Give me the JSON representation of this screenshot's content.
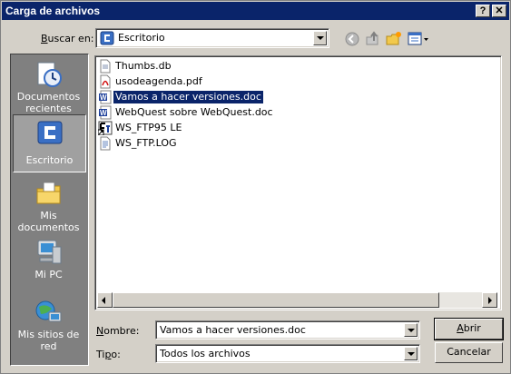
{
  "window": {
    "title": "Carga de archivos",
    "help_button": "?",
    "close_button": "✕"
  },
  "lookin": {
    "label_u": "B",
    "label_rest": "uscar en:",
    "value": "Escritorio"
  },
  "toolbar": {
    "icons": [
      "back-icon",
      "up-folder-icon",
      "new-folder-icon",
      "view-menu-icon"
    ]
  },
  "places": [
    {
      "label": "Documentos recientes",
      "icon": "recent-documents-icon"
    },
    {
      "label": "Escritorio",
      "icon": "desktop-icon",
      "active": true
    },
    {
      "label": "Mis documentos",
      "icon": "my-documents-icon"
    },
    {
      "label": "Mi PC",
      "icon": "my-computer-icon"
    },
    {
      "label": "Mis sitios de red",
      "icon": "network-places-icon"
    }
  ],
  "files": [
    {
      "name": "Thumbs.db",
      "icon": "generic-file-icon"
    },
    {
      "name": "usodeagenda.pdf",
      "icon": "pdf-file-icon"
    },
    {
      "name": "Vamos a hacer versiones.doc",
      "icon": "word-doc-icon",
      "selected": true
    },
    {
      "name": "WebQuest sobre WebQuest.doc",
      "icon": "word-doc-icon"
    },
    {
      "name": "WS_FTP95 LE",
      "icon": "ftp-shortcut-icon"
    },
    {
      "name": "WS_FTP.LOG",
      "icon": "text-file-icon"
    }
  ],
  "filename": {
    "label_u": "N",
    "label_rest": "ombre:",
    "value": "Vamos a hacer versiones.doc"
  },
  "filetype": {
    "label_pre": "Ti",
    "label_u": "p",
    "label_rest": "o:",
    "value": "Todos los archivos"
  },
  "buttons": {
    "open_u": "A",
    "open_rest": "brir",
    "cancel": "Cancelar"
  },
  "colors": {
    "titlebar": "#0a246a",
    "face": "#d4d0c8",
    "places_bg": "#808080",
    "selection": "#0a246a"
  }
}
